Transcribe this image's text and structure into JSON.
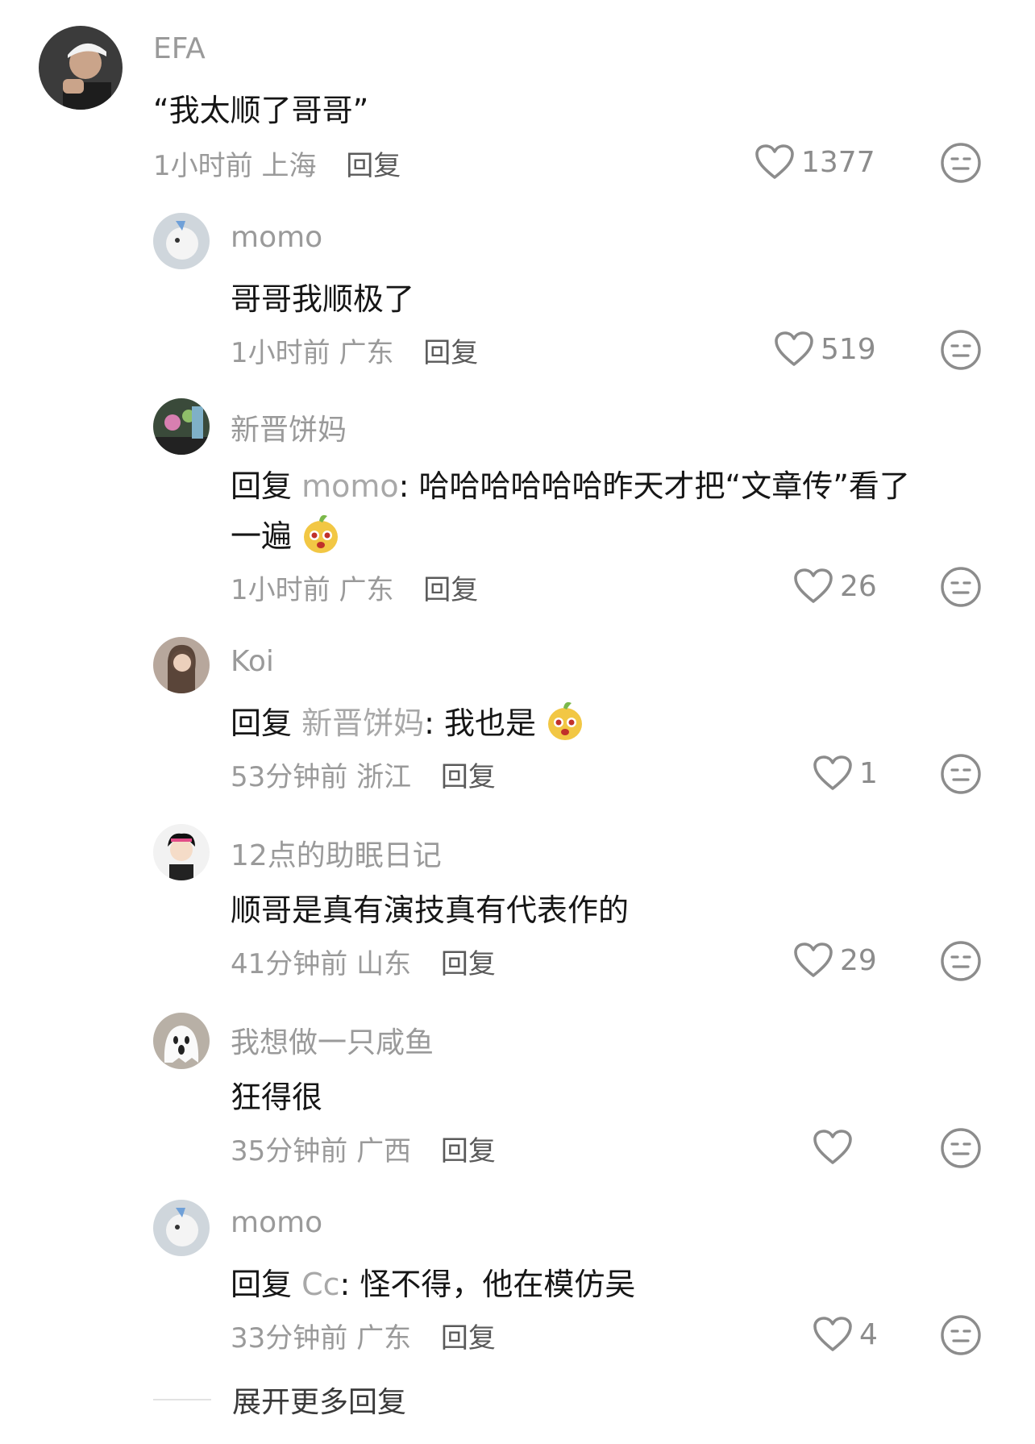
{
  "comments": [
    {
      "name": "EFA",
      "text": "“我太顺了哥哥”",
      "time": "1小时前",
      "location": "上海",
      "reply_label": "回复",
      "likes": "1377"
    },
    {
      "name": "momo",
      "text": "哥哥我顺极了",
      "time": "1小时前",
      "location": "广东",
      "reply_label": "回复",
      "likes": "519"
    },
    {
      "name": "新晋饼妈",
      "reply_prefix": "回复 ",
      "reply_to": "momo",
      "text": ": 哈哈哈哈哈哈昨天才把“文章传”看了",
      "text_line2": "一遍",
      "time": "1小时前",
      "location": "广东",
      "reply_label": "回复",
      "likes": "26"
    },
    {
      "name": "Koi",
      "reply_prefix": "回复 ",
      "reply_to": "新晋饼妈",
      "text": ": 我也是",
      "time": "53分钟前",
      "location": "浙江",
      "reply_label": "回复",
      "likes": "1"
    },
    {
      "name": "12点的助眠日记",
      "text": "顺哥是真有演技真有代表作的",
      "time": "41分钟前",
      "location": "山东",
      "reply_label": "回复",
      "likes": "29"
    },
    {
      "name": "我想做一只咸鱼",
      "text": "狂得很",
      "time": "35分钟前",
      "location": "广西",
      "reply_label": "回复",
      "likes": ""
    },
    {
      "name": "momo",
      "reply_prefix": "回复 ",
      "reply_to": "Cc",
      "text": ": 怪不得，他在模仿吴",
      "time": "33分钟前",
      "location": "广东",
      "reply_label": "回复",
      "likes": "4"
    }
  ],
  "expand_label": "展开更多回复",
  "icons": {
    "like": "heart-outline-icon",
    "dislike": "unamused-face-icon",
    "emoji": "yellow-mascot-emoji"
  },
  "colors": {
    "name": "#9a9a9a",
    "text": "#161616",
    "meta": "#9a9a9a",
    "icon": "#8c8c8c"
  }
}
